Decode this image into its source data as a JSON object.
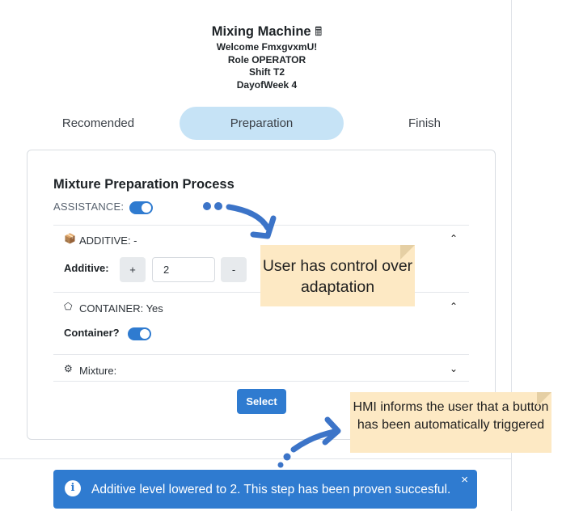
{
  "header": {
    "title": "Mixing Machine",
    "title_icon": "🖩",
    "welcome": "Welcome FmxgvxmU!",
    "role": "Role OPERATOR",
    "shift": "Shift T2",
    "day": "DayofWeek 4"
  },
  "tabs": [
    {
      "label": "Recomended",
      "active": false
    },
    {
      "label": "Preparation",
      "active": true
    },
    {
      "label": "Finish",
      "active": false
    }
  ],
  "process": {
    "title": "Mixture Preparation Process",
    "assistance_label": "ASSISTANCE:",
    "assistance_on": true
  },
  "additive": {
    "header": "ADDITIVE: -",
    "field_label": "Additive:",
    "plus": "+",
    "value": "2",
    "minus": "-"
  },
  "container": {
    "header": "CONTAINER: Yes",
    "field_label": "Container?",
    "toggle_on": true
  },
  "mixture": {
    "header": "Mixture:"
  },
  "select_label": "Select",
  "toast": {
    "icon": "i",
    "message": "Additive level lowered to 2. This step has been proven succesful.",
    "close": "×"
  },
  "callouts": {
    "control": "User has control over adaptation",
    "hmi": "HMI informs the user that a button has been automatically triggered"
  },
  "colors": {
    "accent": "#2f7bd0",
    "tab_active_bg": "#c6e3f6",
    "callout_bg": "#fde9c4",
    "arrow": "#3c74c8"
  },
  "icons": {
    "additive": "cube-icon",
    "container": "cup-icon",
    "mixture": "mixer-icon",
    "expand": "chevron-icon",
    "info": "info-icon",
    "close": "close-icon"
  }
}
